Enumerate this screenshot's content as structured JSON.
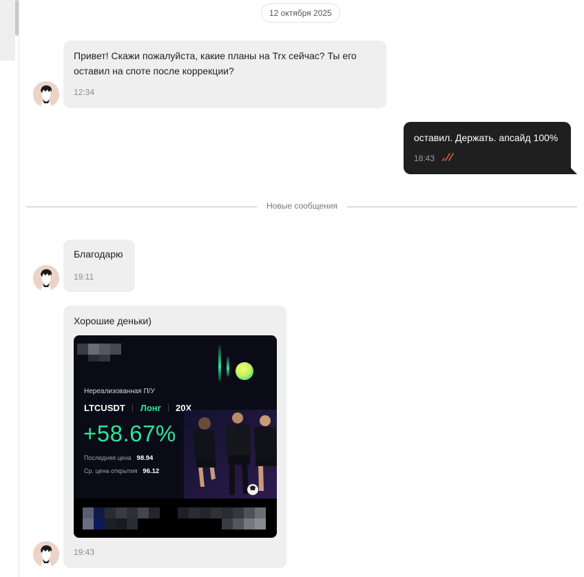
{
  "date_separator": "12 октября 2025",
  "new_messages_label": "Новые сообщения",
  "messages": [
    {
      "direction": "incoming",
      "lines": [
        "Привет! Скажи пожалуйста, какие планы на Trx сейчас? Ты его",
        "оставил на споте после коррекции?"
      ],
      "time": "12:34"
    },
    {
      "direction": "outgoing",
      "lines": [
        "оставил. Держать. апсайд 100%"
      ],
      "time": "18:43",
      "status": "read"
    },
    {
      "direction": "incoming",
      "lines": [
        "Благодарю"
      ],
      "time": "19:11"
    },
    {
      "direction": "incoming",
      "lines": [
        "Хорошие деньки)"
      ],
      "time": "19:43",
      "attachment": {
        "type": "image",
        "pnl_title": "Нереализованная П/У",
        "pair": "LTCUSDT",
        "side": "Лонг",
        "leverage": "20X",
        "pnl_percent": "+58.67%",
        "last_price_label": "Последняя цена",
        "last_price": "98.94",
        "open_price_label": "Ср. цена открытия",
        "open_price": "96.12"
      }
    }
  ],
  "colors": {
    "incoming_bubble": "#efefef",
    "outgoing_bubble": "#1f1f1f",
    "read_ticks": "#e8622a",
    "pnl_green": "#2fe39b"
  }
}
